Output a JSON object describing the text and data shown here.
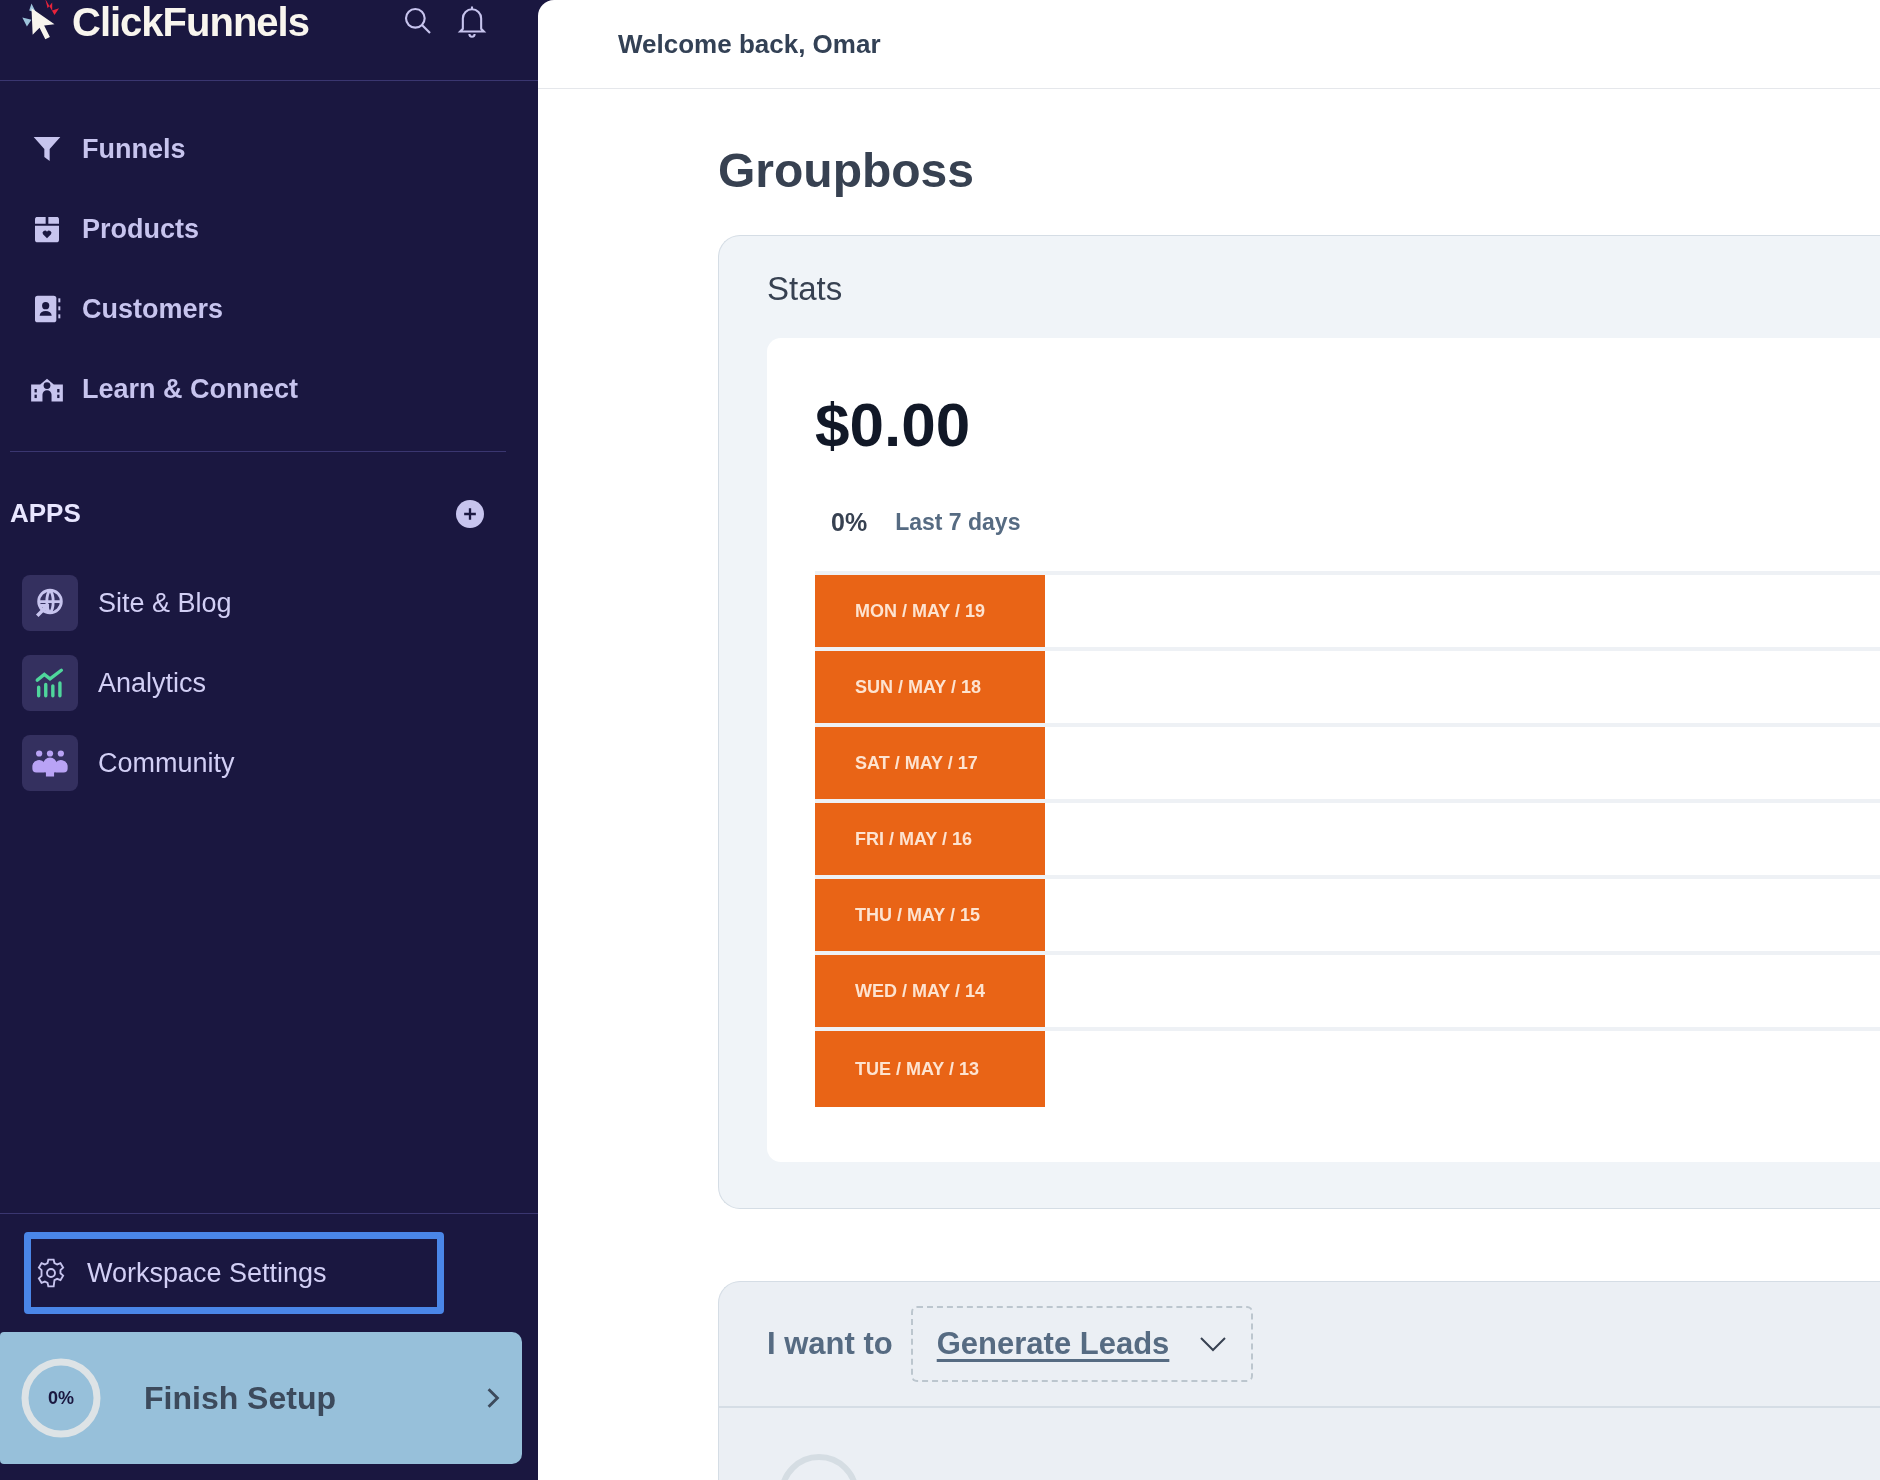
{
  "sidebar": {
    "logo": "ClickFunnels",
    "nav": [
      {
        "label": "Funnels"
      },
      {
        "label": "Products"
      },
      {
        "label": "Customers"
      },
      {
        "label": "Learn & Connect"
      }
    ],
    "apps_heading": "APPS",
    "apps": [
      {
        "label": "Site & Blog"
      },
      {
        "label": "Analytics"
      },
      {
        "label": "Community"
      }
    ],
    "workspace_settings": "Workspace Settings",
    "setup": {
      "percent": "0%",
      "label": "Finish Setup",
      "level": 0
    }
  },
  "header": {
    "welcome": "Welcome back, Omar"
  },
  "page_title": "Groupboss",
  "stats": {
    "title": "Stats",
    "amount": "$0.00",
    "change": "0%",
    "period": "Last 7 days",
    "days": [
      {
        "label": "MON / MAY / 19"
      },
      {
        "label": "SUN / MAY / 18"
      },
      {
        "label": "SAT / MAY / 17"
      },
      {
        "label": "FRI / MAY / 16"
      },
      {
        "label": "THU / MAY / 15"
      },
      {
        "label": "WED / MAY / 14"
      },
      {
        "label": "TUE / MAY / 13"
      }
    ]
  },
  "goal": {
    "prefix": "I want to",
    "value": "Generate Leads"
  }
}
